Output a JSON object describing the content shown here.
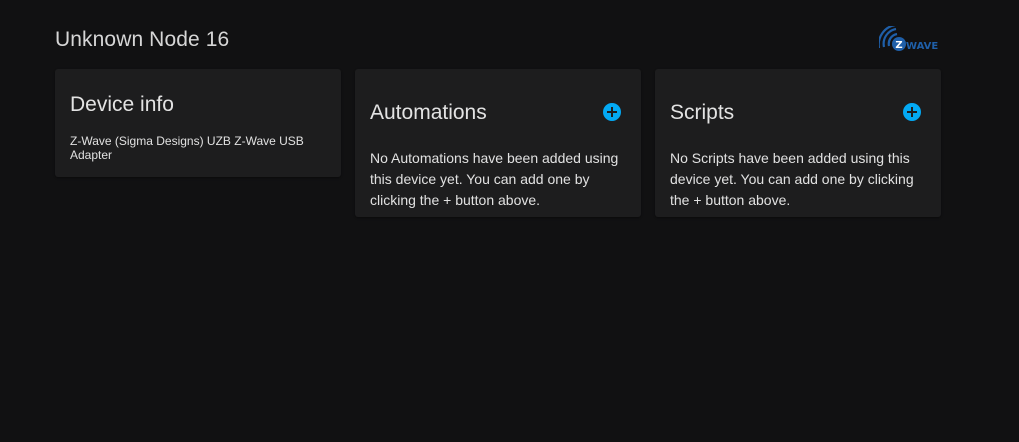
{
  "header": {
    "title": "Unknown Node 16",
    "logo_text": "WAVE",
    "logo_letter": "Z"
  },
  "device_info": {
    "title": "Device info",
    "model": "Z-Wave (Sigma Designs) UZB Z-Wave USB Adapter"
  },
  "automations": {
    "title": "Automations",
    "empty_text": "No Automations have been added using this device yet. You can add one by clicking the + button above.",
    "add_icon": "plus-circle-icon"
  },
  "scripts": {
    "title": "Scripts",
    "empty_text": "No Scripts have been added using this device yet. You can add one by clicking the + button above.",
    "add_icon": "plus-circle-icon"
  },
  "colors": {
    "background": "#111112",
    "card": "#1d1d1e",
    "accent": "#03a9f4",
    "zwave_blue": "#1f5fa8"
  }
}
